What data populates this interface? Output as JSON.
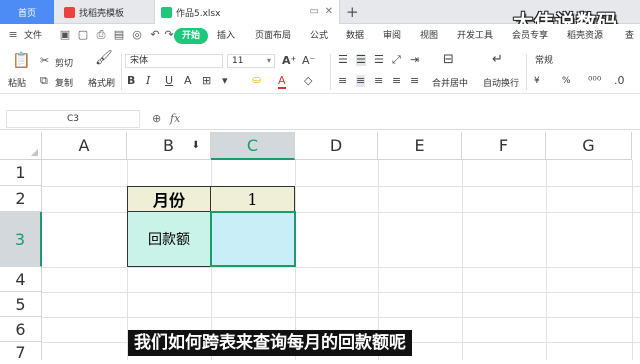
{
  "tabs": [
    {
      "label": "首页"
    },
    {
      "label": "找稻壳模板"
    },
    {
      "label": "作品5.xlsx"
    }
  ],
  "watermark": "大伟说数码",
  "menu": {
    "file": "文件",
    "items": [
      "开始",
      "插入",
      "页面布局",
      "公式",
      "数据",
      "审阅",
      "视图",
      "开发工具",
      "会员专享",
      "稻壳资源",
      "查"
    ]
  },
  "toolbar": {
    "paste": "粘贴",
    "cut": "剪切",
    "copy": "复制",
    "format_painter": "格式刷",
    "font_name": "宋体",
    "font_size": "11",
    "merge_center": "合并居中",
    "wrap_text": "自动换行",
    "number_format": "常规",
    "currency": "¥",
    "percent": "%"
  },
  "formula_bar": {
    "name_box": "C3",
    "fx": "fx",
    "content": ""
  },
  "grid": {
    "columns": [
      "A",
      "B",
      "C",
      "D",
      "E",
      "F",
      "G"
    ],
    "rows": [
      "1",
      "2",
      "3",
      "4",
      "5",
      "6",
      "7"
    ],
    "selected_cell": "C3"
  },
  "cells": {
    "B2": "月份",
    "C2": "1",
    "B3": "回款额",
    "C3": ""
  },
  "colors": {
    "header_cell_bg": "#efefd8",
    "label_cell_bg": "#c9f2e8",
    "selected_cell_bg": "#c9eef7",
    "accent_green": "#1a9c6b",
    "start_button": "#1ec779"
  },
  "subtitle": "我们如何跨表来查询每月的回款额呢"
}
